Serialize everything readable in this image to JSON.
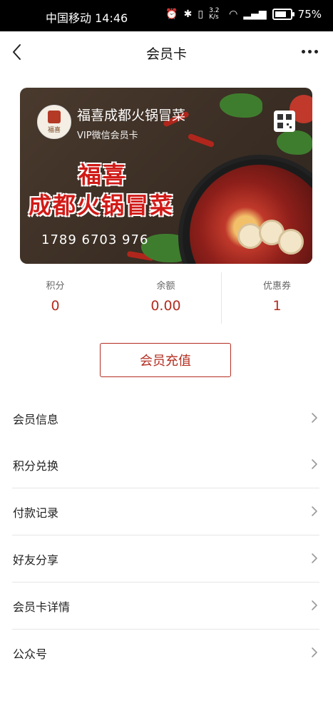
{
  "status_bar": {
    "carrier_time": "中国移动 14:46",
    "speed": "3.2 K/s",
    "battery_percent": "75%",
    "battery_level": 0.75,
    "icons": [
      "alarm-icon",
      "bluetooth-icon",
      "vibrate-icon",
      "wifi-icon",
      "signal-icon",
      "battery-icon"
    ]
  },
  "header": {
    "title": "会员卡",
    "back_icon": "back-arrow-icon",
    "more_icon": "more-dots-icon"
  },
  "card": {
    "store_name": "福喜成都火锅冒菜",
    "card_type": "VIP微信会员卡",
    "promo_line1": "福喜",
    "promo_line2": "成都火锅冒菜",
    "card_number": "1789 6703 976",
    "logo_text": "福喜",
    "qr_icon": "qr-code-icon"
  },
  "stats": [
    {
      "label": "积分",
      "value": "0"
    },
    {
      "label": "余额",
      "value": "0.00"
    },
    {
      "label": "优惠券",
      "value": "1"
    }
  ],
  "recharge_button": "会员充值",
  "menu": [
    {
      "label": "会员信息"
    },
    {
      "label": "积分兑换"
    },
    {
      "label": "付款记录"
    },
    {
      "label": "好友分享"
    },
    {
      "label": "会员卡详情"
    },
    {
      "label": "公众号"
    }
  ],
  "colors": {
    "accent": "#b32d20",
    "status_bar_bg": "#000000",
    "background": "#ffffff"
  }
}
